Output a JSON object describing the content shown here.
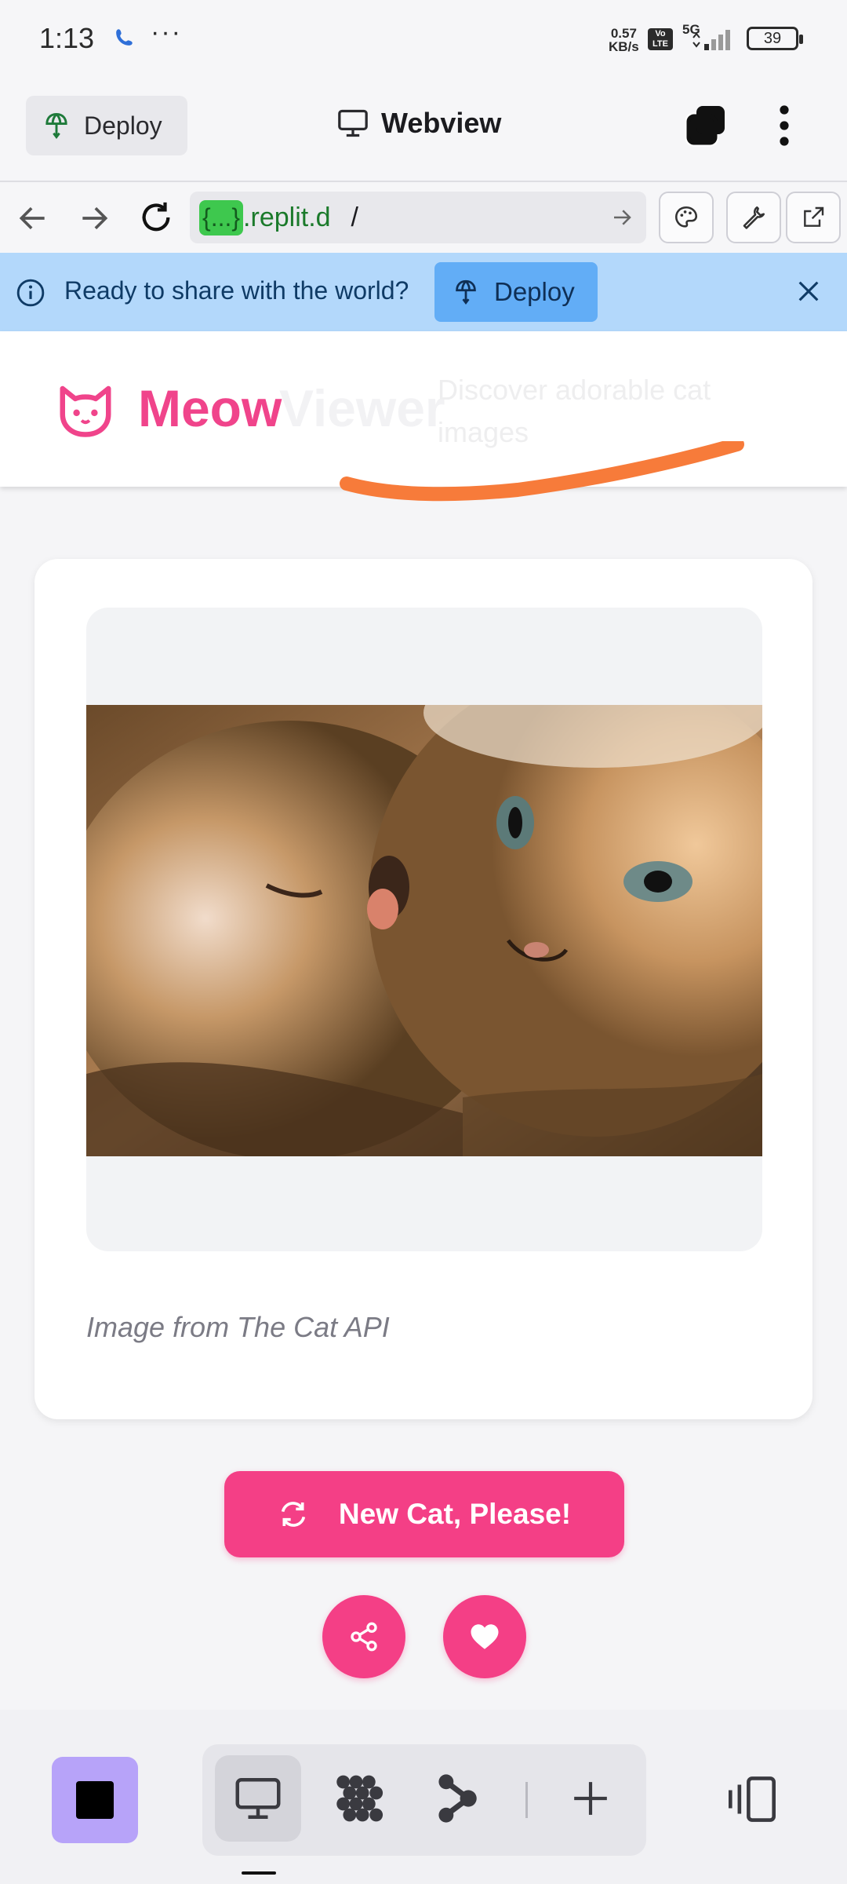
{
  "status_bar": {
    "time": "1:13",
    "dots": "···",
    "net_speed_value": "0.57",
    "net_speed_unit": "KB/s",
    "volte_top": "Vo",
    "volte_bottom": "LTE",
    "network": "5G",
    "battery": "39"
  },
  "app_bar": {
    "deploy_label": "Deploy",
    "title": "Webview"
  },
  "url_bar": {
    "masked": "{...}",
    "host": ".replit.d",
    "path": "/"
  },
  "banner": {
    "text": "Ready to share with the world?",
    "deploy_label": "Deploy"
  },
  "site": {
    "logo_primary": "Meow",
    "logo_secondary": "Viewer",
    "tagline": "Discover adorable cat images",
    "caption": "Image from The Cat API",
    "new_cat_label": "New Cat, Please!"
  },
  "colors": {
    "accent_pink": "#f43f86",
    "banner_blue": "#b3d8fb",
    "stop_purple": "#b7a3f9",
    "scribble_orange": "#f77b3a"
  },
  "icons": {
    "deploy": "deploy-icon",
    "webview": "monitor-icon",
    "tabs": "tabs-icon",
    "menu": "more-vertical-icon",
    "back": "back-arrow-icon",
    "forward": "forward-arrow-icon",
    "reload": "reload-icon",
    "palette": "palette-icon",
    "wrench": "wrench-icon",
    "external": "external-link-icon",
    "info": "info-icon",
    "close": "close-icon",
    "share": "share-icon",
    "heart": "heart-icon",
    "refresh": "refresh-icon"
  }
}
